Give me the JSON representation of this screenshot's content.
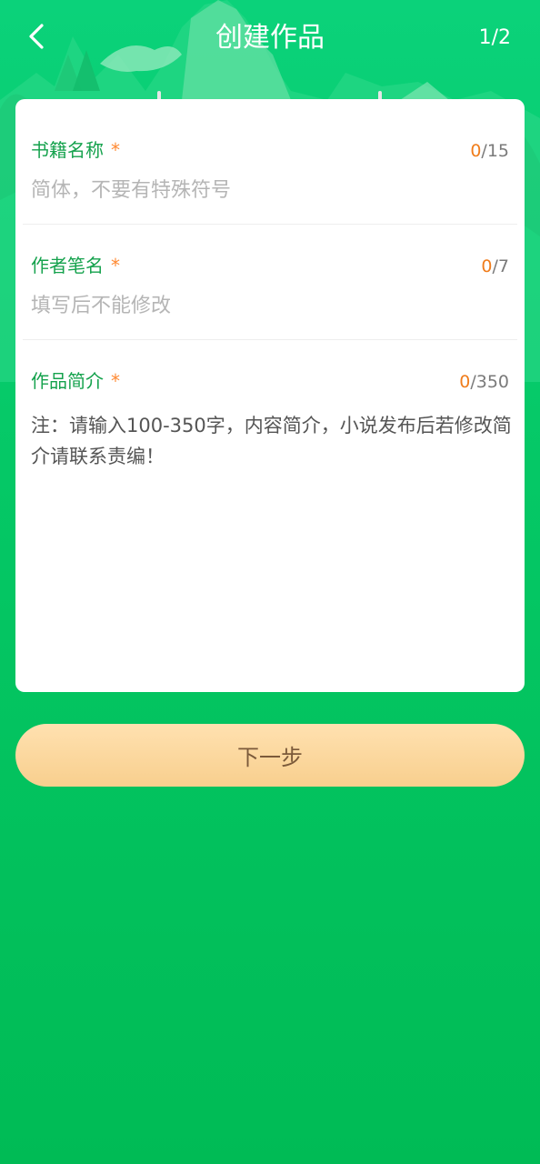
{
  "header": {
    "title": "创建作品",
    "step": "1/2",
    "back_icon": "chevron-left-icon"
  },
  "form": {
    "book_name": {
      "label": "书籍名称",
      "required_mark": "*",
      "count_current": "0",
      "count_max": "/15",
      "placeholder": "简体，不要有特殊符号"
    },
    "pen_name": {
      "label": "作者笔名",
      "required_mark": "*",
      "count_current": "0",
      "count_max": "/7",
      "placeholder": "填写后不能修改"
    },
    "intro": {
      "label": "作品简介",
      "required_mark": "*",
      "count_current": "0",
      "count_max": "/350",
      "hint": "注：请输入100-350字，内容简介，小说发布后若修改简介请联系责编！"
    }
  },
  "next_button_label": "下一步",
  "colors": {
    "background": "#05c866",
    "accent_label": "#15a24d",
    "required": "#ff8a33",
    "counter_current": "#f07d1c",
    "button": "#f8cf8e"
  }
}
